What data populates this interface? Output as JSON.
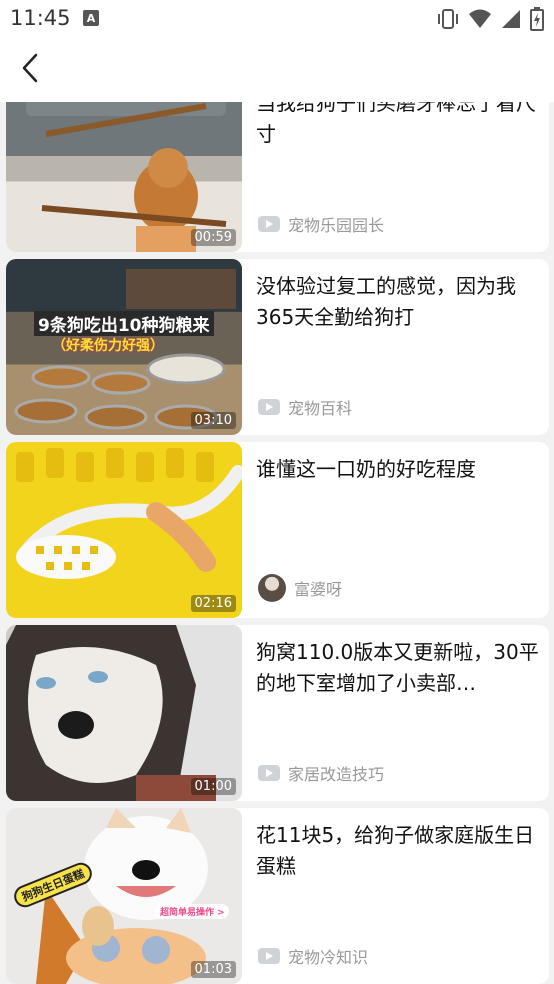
{
  "status_bar": {
    "time": "11:45",
    "notification_icon": "A"
  },
  "nav": {
    "back_icon": "chevron-left-icon"
  },
  "items": [
    {
      "title": "当我给狗子们买磨牙棒忘了看尺寸",
      "duration": "00:59",
      "source": "宠物乐园园长",
      "source_icon": "video-channel-icon"
    },
    {
      "title": "没体验过复工的感觉，因为我365天全勤给狗打",
      "duration": "03:10",
      "source": "宠物百科",
      "source_icon": "video-channel-icon",
      "overlay_line1": "9条狗吃出10种狗粮来",
      "overlay_line2": "（好柔伤力好强）"
    },
    {
      "title": "谁懂这一口奶的好吃程度",
      "duration": "02:16",
      "source": "富婆呀",
      "source_icon": "avatar"
    },
    {
      "title": "狗窝110.0版本又更新啦，30平的地下室增加了小卖部…",
      "duration": "01:00",
      "source": "家居改造技巧",
      "source_icon": "video-channel-icon"
    },
    {
      "title": "花11块5，给狗子做家庭版生日蛋糕",
      "duration": "01:03",
      "source": "宠物冷知识",
      "source_icon": "video-channel-icon",
      "overlay_sticker": "狗狗生日蛋糕",
      "overlay_tag": "超简单易操作 >"
    }
  ]
}
